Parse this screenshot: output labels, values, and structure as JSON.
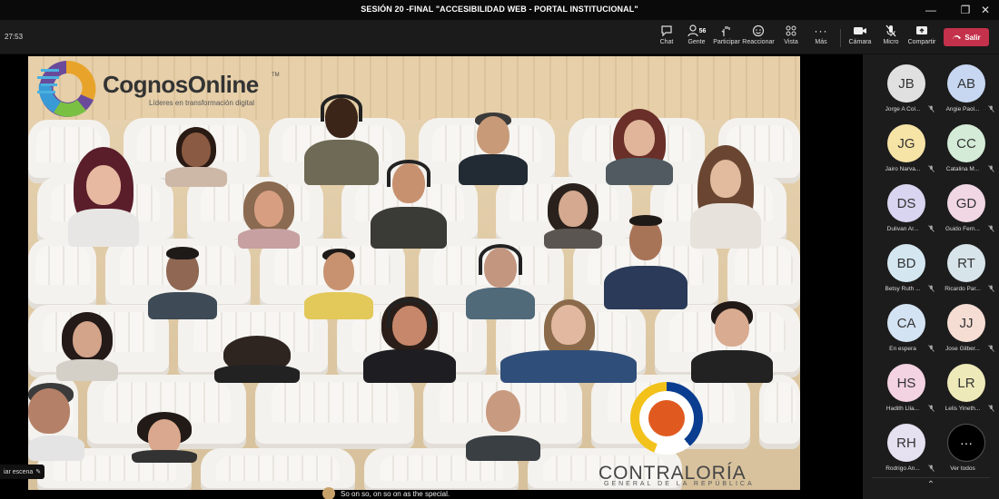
{
  "window": {
    "title": "SESIÓN 20 -FINAL \"ACCESIBILIDAD WEB - PORTAL INSTITUCIONAL\"",
    "controls": {
      "minimize": "—",
      "maximize": "❐",
      "close": "✕"
    }
  },
  "toolbar": {
    "timer": "27:53",
    "items": [
      {
        "label": "Chat",
        "icon": "chat-icon"
      },
      {
        "label": "Gente",
        "icon": "people-icon",
        "count": "56"
      },
      {
        "label": "Participar",
        "icon": "raise-hand-icon"
      },
      {
        "label": "Reaccionar",
        "icon": "smiley-icon"
      },
      {
        "label": "Vista",
        "icon": "grid-view-icon"
      },
      {
        "label": "Más",
        "icon": "more-icon"
      },
      {
        "label": "Cámara",
        "icon": "camera-icon"
      },
      {
        "label": "Micro",
        "icon": "mic-off-icon"
      },
      {
        "label": "Compartir",
        "icon": "share-icon"
      }
    ],
    "leave_label": "Salir",
    "accent": "#c4314b"
  },
  "video": {
    "brand": {
      "name": "CognosOnline",
      "tm": "TM",
      "tagline": "Líderes en transformación digital"
    },
    "contraloria": {
      "name": "CONTRALORÍA",
      "sub": "GENERAL DE LA REPÚBLICA"
    },
    "scene_button": "iar escena"
  },
  "participants": [
    {
      "initials": "JB",
      "name": "Jorge A Col...",
      "color": "#e0e0e0"
    },
    {
      "initials": "AB",
      "name": "Angie Paol...",
      "color": "#c7d7f2"
    },
    {
      "initials": "JG",
      "name": "Jairo Narva...",
      "color": "#f6e3a6"
    },
    {
      "initials": "CC",
      "name": "Catalina M...",
      "color": "#d4ecd7"
    },
    {
      "initials": "DS",
      "name": "Dulivan Ar...",
      "color": "#d9d4ef"
    },
    {
      "initials": "GD",
      "name": "Guido Fern...",
      "color": "#f1d6e4"
    },
    {
      "initials": "BD",
      "name": "Betsy Ruth ...",
      "color": "#d4e7f1"
    },
    {
      "initials": "RT",
      "name": "Ricardo Par...",
      "color": "#d7e4ea"
    },
    {
      "initials": "CA",
      "name": "En espera",
      "color": "#d4e3f3"
    },
    {
      "initials": "JJ",
      "name": "Jose Gilber...",
      "color": "#f6ddd3"
    },
    {
      "initials": "HS",
      "name": "Hadith Llia...",
      "color": "#f3d2e2"
    },
    {
      "initials": "LR",
      "name": "Lelis Yineth...",
      "color": "#eee9b8"
    },
    {
      "initials": "RH",
      "name": "Rodrigo An...",
      "color": "#e6e1f1"
    }
  ],
  "see_all": {
    "label": "Ver todos",
    "glyph": "···"
  },
  "panel_collapse": "⌃",
  "caption": "So on so, on so on as the special."
}
